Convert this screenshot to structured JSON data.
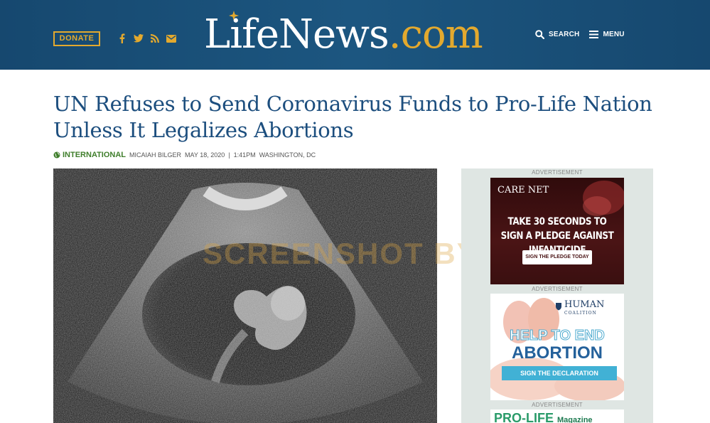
{
  "header": {
    "donate_label": "DONATE",
    "logo_life": "LifeNews",
    "logo_dotcom": ".com",
    "search_label": "SEARCH",
    "menu_label": "MENU",
    "social_icons": [
      "facebook-icon",
      "twitter-icon",
      "rss-icon",
      "email-icon"
    ],
    "colors": {
      "bar": "#1a4f78",
      "accent": "#e3a92e"
    }
  },
  "article": {
    "title": "UN Refuses to Send Coronavirus Funds to Pro-Life Nation Unless It Legalizes Abortions",
    "category": "INTERNATIONAL",
    "author": "MICAIAH BILGER",
    "date": "MAY 18, 2020",
    "separator": "|",
    "time": "1:41PM",
    "location": "WASHINGTON, DC",
    "watermark": "SCREENSHOT BY",
    "colors": {
      "headline": "#1c4e7e",
      "category": "#3f7e2b"
    }
  },
  "sidebar": {
    "ad_label": "ADVERTISEMENT",
    "ads": [
      {
        "brand": "CARE NET",
        "headline": "TAKE 30 SECONDS TO SIGN A PLEDGE AGAINST INFANTICIDE",
        "button": "SIGN THE PLEDGE TODAY"
      },
      {
        "brand": "HUMAN",
        "brand_sub": "COALITION",
        "line1": "HELP TO END",
        "line2": "ABORTION",
        "button": "SIGN THE DECLARATION"
      },
      {
        "brand": "PRO-LIFE",
        "brand_sub": "Magazine"
      }
    ]
  }
}
